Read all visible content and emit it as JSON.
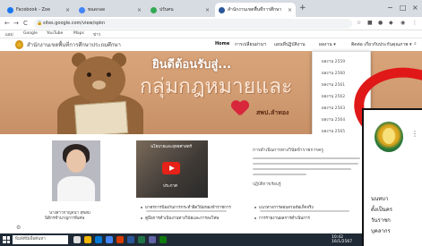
{
  "browser": {
    "tabs": [
      {
        "label": "Facebook - Zoe",
        "color": "#1877f2"
      },
      {
        "label": "พนดกลด",
        "color": "#4285f4"
      },
      {
        "label": "ปรับศน",
        "color": "#34a853"
      },
      {
        "label": "สำนักงานเขตพื้นที่การศึกษา",
        "color": "#2b579a",
        "active": true
      }
    ],
    "new_tab": "+",
    "url": "sites.google.com/view/spkn",
    "back": "←",
    "forward": "→",
    "reload": "C",
    "bookmarks": [
      "แอป",
      "Google",
      "YouTube",
      "Maps",
      "ข่าว"
    ],
    "window_controls": [
      "−",
      "□",
      "×"
    ]
  },
  "site": {
    "title": "สำนักงานเขตพื้นที่การศึกษาประถมศึกษา",
    "menu": [
      {
        "label": "Home",
        "active": true
      },
      {
        "label": "การเปลี่ยนผ่านฯ"
      },
      {
        "label": "แผนที่ปฏิบัติงาน"
      },
      {
        "label": "ผลงาน ▾"
      },
      {
        "label": "ติดต่อ เกี่ยวกับประกันคุณภาพ ▾"
      }
    ],
    "search_icon": "search-icon"
  },
  "banner": {
    "welcome": "ยินดีต้อนรับสู่...",
    "group_name": "กลุ่มกฎหมายและ",
    "slogan": "สพป.ลำทอง"
  },
  "dropdown": {
    "items": [
      "ผลงาน 2559",
      "ผลงาน 2560",
      "ผลงาน 2561",
      "ผลงาน 2562",
      "ผลงาน 2563",
      "ผลงาน 2564",
      "ผลงาน 2565",
      "ผลงาน 2566"
    ]
  },
  "profile": {
    "name": "นางสาวกาญจนา สุขสม",
    "role": "นิติกรชำนาญการพิเศษ"
  },
  "video": {
    "title": "นโยบายและยุทธศาสตร์",
    "subtitle": "ประกาศ"
  },
  "news": {
    "title": "การดำเนินการทางวินัยข้าราชการครู",
    "subtitle": "ปฏิบัติการเรียนรู้",
    "bullets": [
      "มาตรการป้องกันการกระทำผิดวินัยของข้าราชการ",
      "คู่มือการดำเนินงานทางวินัยและการลงโทษ",
      "แนวทางการสอบสวนข้อเท็จจริง",
      "การรายงานผลการดำเนินการ"
    ]
  },
  "overlay": {
    "lines": [
      "นนทบา",
      "ตั้งเป็นคร",
      "วันราชก",
      "บุคลากร"
    ],
    "menu_dots": "⋮"
  },
  "taskbar": {
    "search_placeholder": "พิมพ์ที่นี่เพื่อค้นหา",
    "time": "10:42",
    "date": "16/1/2567"
  }
}
